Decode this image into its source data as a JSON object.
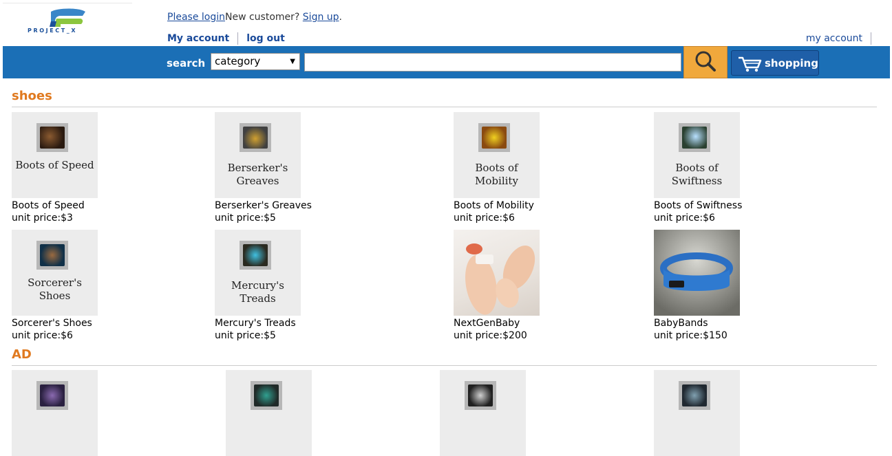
{
  "header": {
    "logo_text": "PROJECT_X",
    "please_login": "Please login",
    "new_customer": "New customer? ",
    "sign_up": "Sign up",
    "period": ".",
    "my_account": "My account",
    "log_out": "log out",
    "my_account_right": "my account"
  },
  "searchbar": {
    "label": "search",
    "category_value": "category",
    "search_value": "",
    "cart_label": "shopping cart",
    "search_icon": "magnifier-icon",
    "cart_icon": "shopping-cart-icon"
  },
  "colors": {
    "brand_blue": "#1b6fb6",
    "accent_orange": "#e07a20",
    "search_button": "#f0a83c"
  },
  "sections": [
    {
      "title": "shoes",
      "products": [
        {
          "name": "Boots of Speed",
          "price": "unit price:$3",
          "caption": "Boots of Speed"
        },
        {
          "name": "Berserker's Greaves",
          "price": "unit price:$5",
          "caption": "Berserker's Greaves"
        },
        {
          "name": "Boots of Mobility",
          "price": "unit price:$6",
          "caption": "Boots of Mobility"
        },
        {
          "name": "Boots of Swiftness",
          "price": "unit price:$6",
          "caption": "Boots of Swiftness"
        },
        {
          "name": "Sorcerer's Shoes",
          "price": "unit price:$6",
          "caption": "Sorcerer's Shoes"
        },
        {
          "name": "Mercury's Treads",
          "price": "unit price:$5",
          "caption": "Mercury's Treads"
        },
        {
          "name": "NextGenBaby",
          "price": "unit price:$200",
          "caption": ""
        },
        {
          "name": "BabyBands",
          "price": "unit price:$150",
          "caption": ""
        }
      ]
    },
    {
      "title": "AD"
    }
  ]
}
